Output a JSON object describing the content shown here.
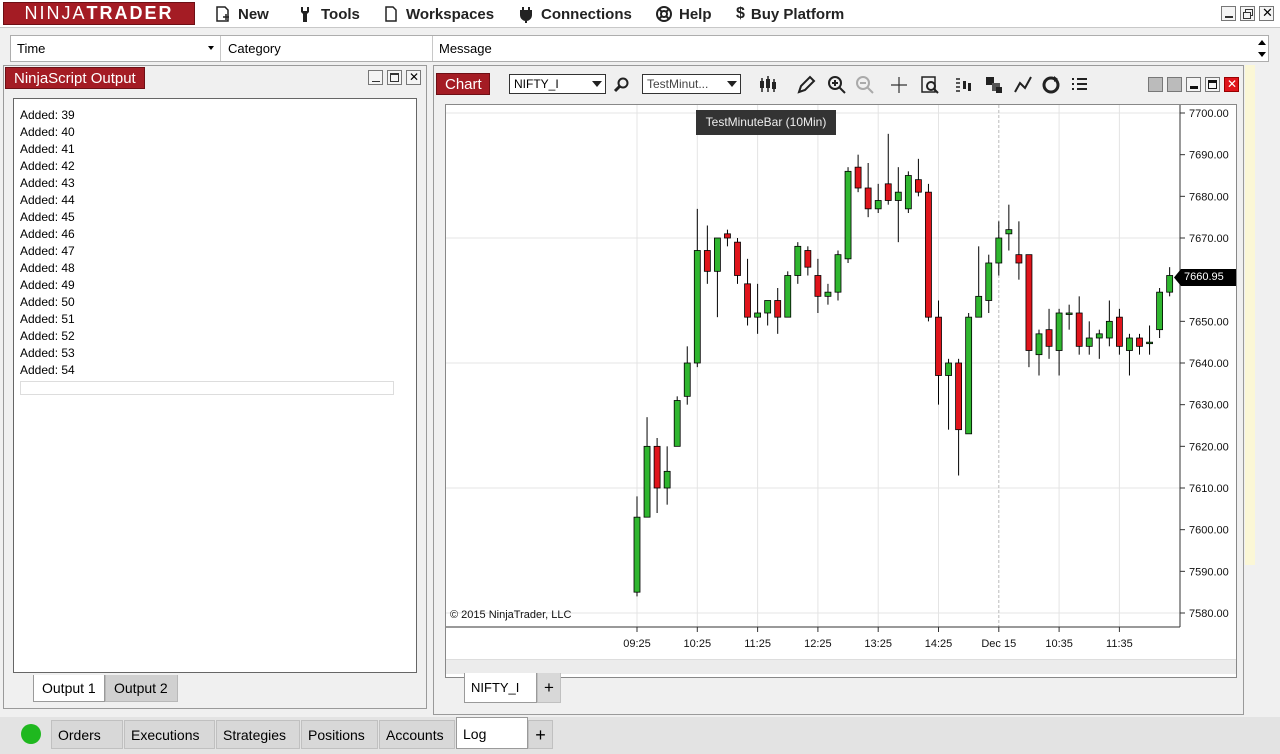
{
  "app": {
    "logo_left": "NINJA",
    "logo_right": "TRADER"
  },
  "menu": {
    "new": "New",
    "tools": "Tools",
    "workspaces": "Workspaces",
    "connections": "Connections",
    "help": "Help",
    "buy": "Buy Platform"
  },
  "log_grid": {
    "columns": [
      "Time",
      "Category",
      "Message"
    ]
  },
  "output": {
    "title": "NinjaScript Output",
    "lines": [
      "Added: 39",
      "Added: 40",
      "Added: 41",
      "Added: 42",
      "Added: 43",
      "Added: 44",
      "Added: 45",
      "Added: 46",
      "Added: 47",
      "Added: 48",
      "Added: 49",
      "Added: 50",
      "Added: 51",
      "Added: 52",
      "Added: 53",
      "Added: 54"
    ],
    "tabs": [
      "Output 1",
      "Output 2"
    ],
    "active_tab": "Output 1"
  },
  "chart": {
    "title": "Chart",
    "instrument": "NIFTY_I",
    "bar_type": "TestMinut...",
    "tooltip": "TestMinuteBar (10Min)",
    "copyright": "© 2015 NinjaTrader, LLC",
    "tab": "NIFTY_I",
    "add_tab": "+"
  },
  "bottom_tabs": {
    "items": [
      "Orders",
      "Executions",
      "Strategies",
      "Positions",
      "Accounts",
      "Log"
    ],
    "active": "Log",
    "add": "+"
  },
  "colors": {
    "brand": "#a41c24",
    "up": "#2fb62f",
    "down": "#e0141b",
    "wick": "#000000"
  },
  "chart_data": {
    "type": "candlestick",
    "title": "",
    "ylim": [
      7578,
      7704
    ],
    "y_ticks": [
      "7700.00",
      "7690.00",
      "7680.00",
      "7670.00",
      "7660.00",
      "7650.00",
      "7640.00",
      "7630.00",
      "7620.00",
      "7610.00",
      "7600.00",
      "7590.00",
      "7580.00"
    ],
    "x_ticks": [
      "09:25",
      "10:25",
      "11:25",
      "12:25",
      "13:25",
      "14:25",
      "Dec 15",
      "10:35",
      "11:35"
    ],
    "last_price": "7660.95",
    "grid": true,
    "candles": [
      {
        "o": 7585,
        "h": 7608,
        "l": 7584,
        "c": 7603
      },
      {
        "o": 7603,
        "h": 7627,
        "l": 7603,
        "c": 7620
      },
      {
        "o": 7620,
        "h": 7622,
        "l": 7604,
        "c": 7610
      },
      {
        "o": 7610,
        "h": 7620,
        "l": 7606,
        "c": 7614
      },
      {
        "o": 7620,
        "h": 7632,
        "l": 7620,
        "c": 7631
      },
      {
        "o": 7632,
        "h": 7644,
        "l": 7630,
        "c": 7640
      },
      {
        "o": 7640,
        "h": 7677,
        "l": 7639,
        "c": 7667
      },
      {
        "o": 7667,
        "h": 7673,
        "l": 7659,
        "c": 7662
      },
      {
        "o": 7662,
        "h": 7670,
        "l": 7651,
        "c": 7670
      },
      {
        "o": 7671,
        "h": 7672,
        "l": 7668,
        "c": 7670
      },
      {
        "o": 7669,
        "h": 7670,
        "l": 7659,
        "c": 7661
      },
      {
        "o": 7659,
        "h": 7665,
        "l": 7649,
        "c": 7651
      },
      {
        "o": 7651,
        "h": 7659,
        "l": 7647,
        "c": 7652
      },
      {
        "o": 7652,
        "h": 7655,
        "l": 7649,
        "c": 7655
      },
      {
        "o": 7655,
        "h": 7658,
        "l": 7647,
        "c": 7651
      },
      {
        "o": 7651,
        "h": 7662,
        "l": 7651,
        "c": 7661
      },
      {
        "o": 7661,
        "h": 7669,
        "l": 7659,
        "c": 7668
      },
      {
        "o": 7667,
        "h": 7668,
        "l": 7661,
        "c": 7663
      },
      {
        "o": 7661,
        "h": 7665,
        "l": 7652,
        "c": 7656
      },
      {
        "o": 7656,
        "h": 7659,
        "l": 7654,
        "c": 7657
      },
      {
        "o": 7657,
        "h": 7667,
        "l": 7655,
        "c": 7666
      },
      {
        "o": 7665,
        "h": 7687,
        "l": 7664,
        "c": 7686
      },
      {
        "o": 7687,
        "h": 7690,
        "l": 7681,
        "c": 7682
      },
      {
        "o": 7682,
        "h": 7688,
        "l": 7675,
        "c": 7677
      },
      {
        "o": 7677,
        "h": 7683,
        "l": 7676,
        "c": 7679
      },
      {
        "o": 7683,
        "h": 7695,
        "l": 7678,
        "c": 7679
      },
      {
        "o": 7679,
        "h": 7687,
        "l": 7669,
        "c": 7681
      },
      {
        "o": 7677,
        "h": 7686,
        "l": 7676,
        "c": 7685
      },
      {
        "o": 7684,
        "h": 7689,
        "l": 7680,
        "c": 7681
      },
      {
        "o": 7681,
        "h": 7683,
        "l": 7650,
        "c": 7651
      },
      {
        "o": 7651,
        "h": 7655,
        "l": 7630,
        "c": 7637
      },
      {
        "o": 7637,
        "h": 7641,
        "l": 7624,
        "c": 7640
      },
      {
        "o": 7640,
        "h": 7641,
        "l": 7613,
        "c": 7624
      },
      {
        "o": 7623,
        "h": 7652,
        "l": 7623,
        "c": 7651
      },
      {
        "o": 7651,
        "h": 7668,
        "l": 7651,
        "c": 7656
      },
      {
        "o": 7655,
        "h": 7666,
        "l": 7652,
        "c": 7664
      },
      {
        "o": 7664,
        "h": 7674,
        "l": 7661,
        "c": 7670
      },
      {
        "o": 7671,
        "h": 7678,
        "l": 7667,
        "c": 7672
      },
      {
        "o": 7666,
        "h": 7674,
        "l": 7660,
        "c": 7664
      },
      {
        "o": 7666,
        "h": 7666,
        "l": 7639,
        "c": 7643
      },
      {
        "o": 7642,
        "h": 7648,
        "l": 7637,
        "c": 7647
      },
      {
        "o": 7648,
        "h": 7653,
        "l": 7641,
        "c": 7644
      },
      {
        "o": 7643,
        "h": 7653,
        "l": 7637,
        "c": 7652
      },
      {
        "o": 7652,
        "h": 7654,
        "l": 7648,
        "c": 7652
      },
      {
        "o": 7652,
        "h": 7656,
        "l": 7642,
        "c": 7644
      },
      {
        "o": 7644,
        "h": 7650,
        "l": 7642,
        "c": 7646
      },
      {
        "o": 7646,
        "h": 7648,
        "l": 7641,
        "c": 7647
      },
      {
        "o": 7646,
        "h": 7655,
        "l": 7644,
        "c": 7650
      },
      {
        "o": 7651,
        "h": 7653,
        "l": 7642,
        "c": 7644
      },
      {
        "o": 7643,
        "h": 7647,
        "l": 7637,
        "c": 7646
      },
      {
        "o": 7646,
        "h": 7647,
        "l": 7642,
        "c": 7644
      },
      {
        "o": 7645,
        "h": 7649,
        "l": 7642,
        "c": 7645
      },
      {
        "o": 7648,
        "h": 7658,
        "l": 7646,
        "c": 7657
      },
      {
        "o": 7657,
        "h": 7663,
        "l": 7656,
        "c": 7661
      }
    ]
  }
}
